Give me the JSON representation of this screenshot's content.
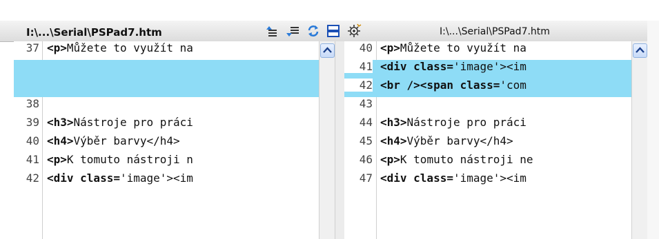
{
  "toolbar": {
    "left_path": "I:\\...\\Serial\\PSPad7.htm",
    "right_path": "I:\\...\\Serial\\PSPad7.htm",
    "icons": [
      "prev-diff-icon",
      "next-diff-icon",
      "refresh-icon",
      "toggle-view-icon",
      "settings-icon"
    ]
  },
  "left_pane": {
    "lines": [
      {
        "num": "37",
        "tag": "<p>",
        "rest": "Můžete to využít na",
        "hl": false
      },
      {
        "num": "",
        "tag": "",
        "rest": "",
        "hl": true
      },
      {
        "num": "",
        "tag": "",
        "rest": "",
        "hl": true
      },
      {
        "num": "38",
        "tag": "",
        "rest": "",
        "hl": false
      },
      {
        "num": "39",
        "tag": "<h3>",
        "rest": "Nástroje pro práci",
        "hl": false
      },
      {
        "num": "40",
        "tag": "<h4>",
        "rest": "Výběr barvy</h4>",
        "hl": false
      },
      {
        "num": "41",
        "tag": "<p>",
        "rest": "K tomuto nástroji n",
        "hl": false
      },
      {
        "num": "42",
        "tag": "<div class=",
        "rest": "'image'><im",
        "hl": false
      }
    ]
  },
  "right_pane": {
    "lines": [
      {
        "num": "40",
        "tag": "<p>",
        "rest": "Můžete to využít na",
        "hl": false
      },
      {
        "num": "41",
        "tag": "<div class=",
        "rest": "'image'><im",
        "hl": true
      },
      {
        "num": "42",
        "tag": "<br /><span class=",
        "rest": "'com",
        "hl": true
      },
      {
        "num": "43",
        "tag": "",
        "rest": "",
        "hl": false
      },
      {
        "num": "44",
        "tag": "<h3>",
        "rest": "Nástroje pro práci",
        "hl": false
      },
      {
        "num": "45",
        "tag": "<h4>",
        "rest": "Výběr barvy</h4>",
        "hl": false
      },
      {
        "num": "46",
        "tag": "<p>",
        "rest": "K tomuto nástroji ne",
        "hl": false
      },
      {
        "num": "47",
        "tag": "<div class=",
        "rest": "'image'><im",
        "hl": false
      }
    ]
  }
}
